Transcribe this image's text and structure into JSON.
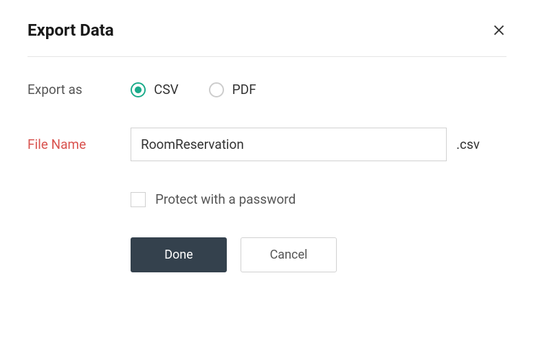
{
  "dialog": {
    "title": "Export Data"
  },
  "form": {
    "export_as_label": "Export as",
    "radio_csv": "CSV",
    "radio_pdf": "PDF",
    "file_name_label": "File Name",
    "file_name_value": "RoomReservation",
    "file_extension": ".csv",
    "protect_label": "Protect with a password"
  },
  "actions": {
    "done_label": "Done",
    "cancel_label": "Cancel"
  }
}
